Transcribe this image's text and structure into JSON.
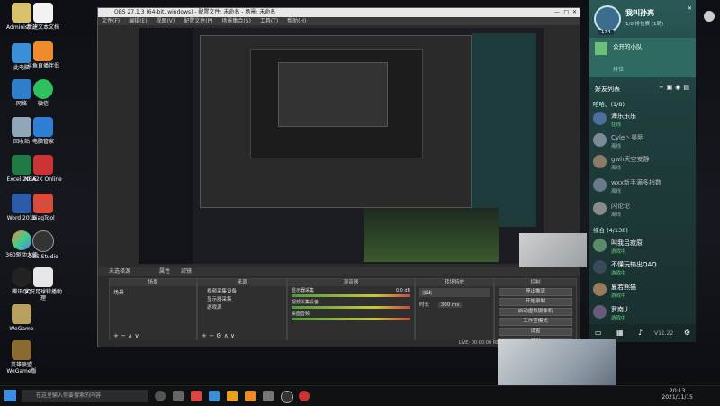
{
  "desktop": {
    "icons_col1": [
      "Administr...",
      "此电脑",
      "网络",
      "回收站",
      "Excel 2016",
      "Word 2016",
      "360驱动大师",
      "腾讯QQ",
      "WeGame",
      "英雄联盟WeGame版"
    ],
    "icons_col2": [
      "新建文本文档",
      "斗鱼直播伴侣",
      "微信",
      "电脑管家",
      "NBA2K Online",
      "DiagTool",
      "OBS Studio",
      "实况足球转播助理"
    ]
  },
  "obs": {
    "title": "OBS 27.1.3 (64-bit, windows) - 配置文件: 未命名 - 场景: 未命名",
    "menu": [
      "文件(F)",
      "编辑(E)",
      "视图(V)",
      "配置文件(P)",
      "场景集合(S)",
      "工具(T)",
      "帮助(H)"
    ],
    "no_source": "未选择源",
    "toolbar": [
      "属性",
      "滤镜"
    ],
    "docks": {
      "scenes": "场景",
      "sources": "来源",
      "mixer": "混音器",
      "transitions": "转场特效",
      "controls": "控制"
    },
    "scene_item": "场景",
    "sources": [
      "视频采集设备",
      "显示器采集",
      "游戏源"
    ],
    "mixer_tracks": [
      "显示器采集",
      "视频采集设备",
      "桌面音频"
    ],
    "mixer_db": "0.0 dB",
    "transition": {
      "type": "淡出",
      "duration_label": "时长",
      "duration": "300 ms"
    },
    "controls": [
      "停止推流",
      "开始录制",
      "启动虚拟摄像机",
      "工作室模式",
      "设置",
      "退出"
    ],
    "status": "LIVE: 00:00:00   REC: 00:00:00   CPU: 3.2%, 30.00 fps"
  },
  "qq": {
    "name": "我叫孙亮",
    "subtitle": "1/8 排位赛 (1局)",
    "level": "174",
    "team_title": "公开的小队",
    "team_status": "排位",
    "friends_header": "好友列表",
    "groups": [
      {
        "label": "哈哈、(1/8)"
      },
      {
        "label": "综合 (4/138)"
      }
    ],
    "friends_group1": [
      {
        "name": "海乐乐乐",
        "status": "在线"
      },
      {
        "name": "Cyle丶昊明",
        "status": "离线"
      },
      {
        "name": "gwh天空安静",
        "status": "离线"
      },
      {
        "name": "wxx新手满多指数",
        "status": "离线"
      },
      {
        "name": "闪论论",
        "status": "离线"
      }
    ],
    "friends_group2": [
      {
        "name": "叫我吕寂原",
        "status": "游戏中"
      },
      {
        "name": "不懂玩输出QAQ",
        "status": "游戏中"
      },
      {
        "name": "夏若熊猫",
        "status": "游戏中"
      },
      {
        "name": "罗南丿",
        "status": "游戏中"
      }
    ],
    "version": "V11.22"
  },
  "taskbar": {
    "search_placeholder": "在这里输入你要搜索的内容",
    "time": "20:13",
    "date": "2021/11/15"
  }
}
